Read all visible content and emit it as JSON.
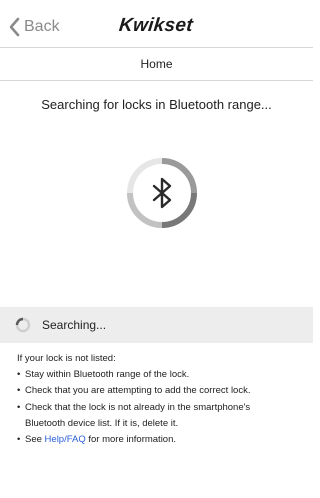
{
  "header": {
    "back_label": "Back",
    "brand": "Kwikset",
    "icons": {
      "back": "chevron-left-icon"
    }
  },
  "subbar": {
    "title": "Home"
  },
  "main": {
    "searching_title": "Searching for locks in Bluetooth range...",
    "icons": {
      "spinner": "bluetooth-icon"
    }
  },
  "status": {
    "text": "Searching...",
    "icons": {
      "spinner": "loading-spinner-icon"
    }
  },
  "help": {
    "intro": "If your lock is not listed:",
    "bullet": "•",
    "item1": "Stay within Bluetooth range of the lock.",
    "item2": "Check that you are attempting to add the correct lock.",
    "item3_line1": "Check that the lock is not already in the smartphone's",
    "item3_line2": "Bluetooth device list. If it is, delete it.",
    "item4_prefix": "See ",
    "item4_link": "Help/FAQ",
    "item4_suffix": " for more information."
  },
  "colors": {
    "link": "#2a5fd8",
    "status_background": "#ededed",
    "divider": "#d6d6d6"
  }
}
